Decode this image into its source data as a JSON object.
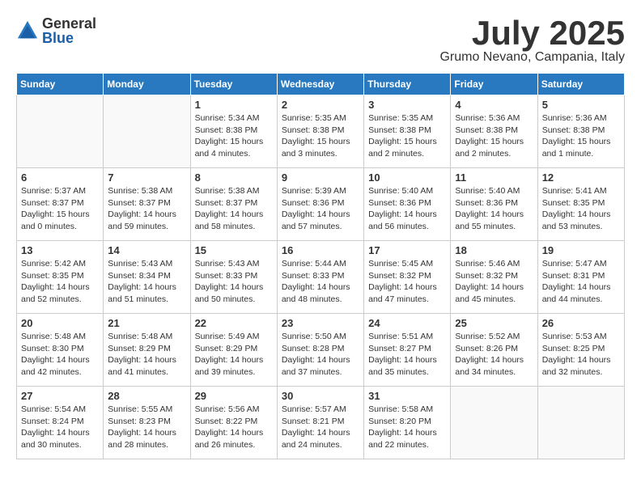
{
  "header": {
    "logo_general": "General",
    "logo_blue": "Blue",
    "month_title": "July 2025",
    "location": "Grumo Nevano, Campania, Italy"
  },
  "weekdays": [
    "Sunday",
    "Monday",
    "Tuesday",
    "Wednesday",
    "Thursday",
    "Friday",
    "Saturday"
  ],
  "weeks": [
    [
      {
        "day": "",
        "info": ""
      },
      {
        "day": "",
        "info": ""
      },
      {
        "day": "1",
        "info": "Sunrise: 5:34 AM\nSunset: 8:38 PM\nDaylight: 15 hours and 4 minutes."
      },
      {
        "day": "2",
        "info": "Sunrise: 5:35 AM\nSunset: 8:38 PM\nDaylight: 15 hours and 3 minutes."
      },
      {
        "day": "3",
        "info": "Sunrise: 5:35 AM\nSunset: 8:38 PM\nDaylight: 15 hours and 2 minutes."
      },
      {
        "day": "4",
        "info": "Sunrise: 5:36 AM\nSunset: 8:38 PM\nDaylight: 15 hours and 2 minutes."
      },
      {
        "day": "5",
        "info": "Sunrise: 5:36 AM\nSunset: 8:38 PM\nDaylight: 15 hours and 1 minute."
      }
    ],
    [
      {
        "day": "6",
        "info": "Sunrise: 5:37 AM\nSunset: 8:37 PM\nDaylight: 15 hours and 0 minutes."
      },
      {
        "day": "7",
        "info": "Sunrise: 5:38 AM\nSunset: 8:37 PM\nDaylight: 14 hours and 59 minutes."
      },
      {
        "day": "8",
        "info": "Sunrise: 5:38 AM\nSunset: 8:37 PM\nDaylight: 14 hours and 58 minutes."
      },
      {
        "day": "9",
        "info": "Sunrise: 5:39 AM\nSunset: 8:36 PM\nDaylight: 14 hours and 57 minutes."
      },
      {
        "day": "10",
        "info": "Sunrise: 5:40 AM\nSunset: 8:36 PM\nDaylight: 14 hours and 56 minutes."
      },
      {
        "day": "11",
        "info": "Sunrise: 5:40 AM\nSunset: 8:36 PM\nDaylight: 14 hours and 55 minutes."
      },
      {
        "day": "12",
        "info": "Sunrise: 5:41 AM\nSunset: 8:35 PM\nDaylight: 14 hours and 53 minutes."
      }
    ],
    [
      {
        "day": "13",
        "info": "Sunrise: 5:42 AM\nSunset: 8:35 PM\nDaylight: 14 hours and 52 minutes."
      },
      {
        "day": "14",
        "info": "Sunrise: 5:43 AM\nSunset: 8:34 PM\nDaylight: 14 hours and 51 minutes."
      },
      {
        "day": "15",
        "info": "Sunrise: 5:43 AM\nSunset: 8:33 PM\nDaylight: 14 hours and 50 minutes."
      },
      {
        "day": "16",
        "info": "Sunrise: 5:44 AM\nSunset: 8:33 PM\nDaylight: 14 hours and 48 minutes."
      },
      {
        "day": "17",
        "info": "Sunrise: 5:45 AM\nSunset: 8:32 PM\nDaylight: 14 hours and 47 minutes."
      },
      {
        "day": "18",
        "info": "Sunrise: 5:46 AM\nSunset: 8:32 PM\nDaylight: 14 hours and 45 minutes."
      },
      {
        "day": "19",
        "info": "Sunrise: 5:47 AM\nSunset: 8:31 PM\nDaylight: 14 hours and 44 minutes."
      }
    ],
    [
      {
        "day": "20",
        "info": "Sunrise: 5:48 AM\nSunset: 8:30 PM\nDaylight: 14 hours and 42 minutes."
      },
      {
        "day": "21",
        "info": "Sunrise: 5:48 AM\nSunset: 8:29 PM\nDaylight: 14 hours and 41 minutes."
      },
      {
        "day": "22",
        "info": "Sunrise: 5:49 AM\nSunset: 8:29 PM\nDaylight: 14 hours and 39 minutes."
      },
      {
        "day": "23",
        "info": "Sunrise: 5:50 AM\nSunset: 8:28 PM\nDaylight: 14 hours and 37 minutes."
      },
      {
        "day": "24",
        "info": "Sunrise: 5:51 AM\nSunset: 8:27 PM\nDaylight: 14 hours and 35 minutes."
      },
      {
        "day": "25",
        "info": "Sunrise: 5:52 AM\nSunset: 8:26 PM\nDaylight: 14 hours and 34 minutes."
      },
      {
        "day": "26",
        "info": "Sunrise: 5:53 AM\nSunset: 8:25 PM\nDaylight: 14 hours and 32 minutes."
      }
    ],
    [
      {
        "day": "27",
        "info": "Sunrise: 5:54 AM\nSunset: 8:24 PM\nDaylight: 14 hours and 30 minutes."
      },
      {
        "day": "28",
        "info": "Sunrise: 5:55 AM\nSunset: 8:23 PM\nDaylight: 14 hours and 28 minutes."
      },
      {
        "day": "29",
        "info": "Sunrise: 5:56 AM\nSunset: 8:22 PM\nDaylight: 14 hours and 26 minutes."
      },
      {
        "day": "30",
        "info": "Sunrise: 5:57 AM\nSunset: 8:21 PM\nDaylight: 14 hours and 24 minutes."
      },
      {
        "day": "31",
        "info": "Sunrise: 5:58 AM\nSunset: 8:20 PM\nDaylight: 14 hours and 22 minutes."
      },
      {
        "day": "",
        "info": ""
      },
      {
        "day": "",
        "info": ""
      }
    ]
  ]
}
